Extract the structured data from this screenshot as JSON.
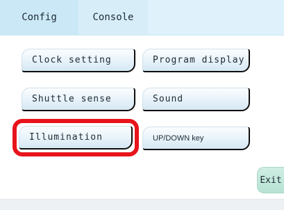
{
  "tabs": {
    "config": "Config",
    "console": "Console"
  },
  "buttons": {
    "clock_setting": "Clock setting",
    "program_display": "Program display",
    "shuttle_sense": "Shuttle sense",
    "sound": "Sound",
    "illumination": "Illumination",
    "updown_key": "UP/DOWN key"
  },
  "exit_label": "Exit",
  "colors": {
    "highlight": "#e8141b",
    "tab_bar": "#dff2fb",
    "exit_button": "#b7e2d3"
  }
}
